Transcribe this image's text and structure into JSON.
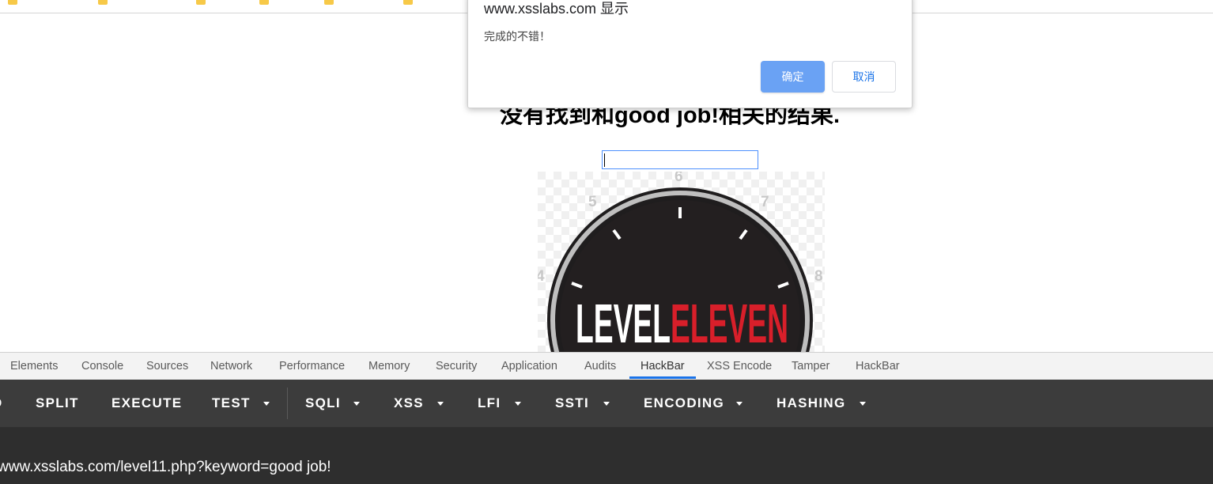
{
  "dialog": {
    "origin": "www.xsslabs.com 显示",
    "message": "完成的不错！",
    "ok_label": "确定",
    "cancel_label": "取消"
  },
  "page": {
    "heading": "没有找到和good job!相关的结果.",
    "image_text_left": "LEVEL",
    "image_text_right": "ELEVEN",
    "image_dial_numbers": [
      "4",
      "5",
      "6",
      "7",
      "8"
    ]
  },
  "devtools": {
    "tabs": [
      "Elements",
      "Console",
      "Sources",
      "Network",
      "Performance",
      "Memory",
      "Security",
      "Application",
      "Audits",
      "HackBar",
      "XSS Encode",
      "Tamper",
      "HackBar"
    ],
    "active_tab": "HackBar"
  },
  "hackbar": {
    "buttons": [
      "D",
      "SPLIT",
      "EXECUTE",
      "TEST",
      "SQLI",
      "XSS",
      "LFI",
      "SSTI",
      "ENCODING",
      "HASHING"
    ],
    "url": "www.xsslabs.com/level11.php?keyword=good job!"
  },
  "colors": {
    "ok_button": "#6aa2f4",
    "cancel_text": "#1a73e8",
    "tab_underline": "#1a73e8",
    "toolbar_bg": "#3c3c3c",
    "url_area_bg": "#2e2e2e",
    "logo_red": "#d81f2a"
  }
}
